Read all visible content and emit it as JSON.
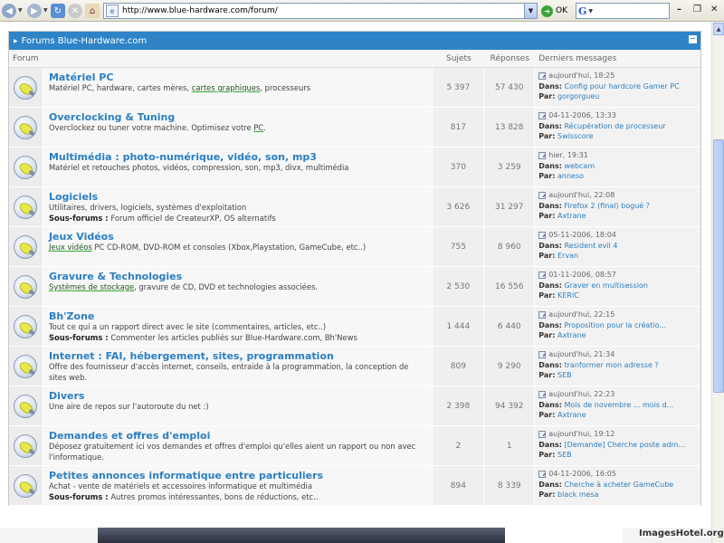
{
  "browser": {
    "url": "http://www.blue-hardware.com/forum/",
    "go_label": "OK"
  },
  "forum": {
    "header_title": "Forums Blue-Hardware.com",
    "columns": {
      "forum": "Forum",
      "topics": "Sujets",
      "posts": "Réponses",
      "last": "Derniers messages"
    },
    "labels": {
      "in": "Dans:",
      "by": "Par:",
      "subforums": "Sous-forums :"
    },
    "rows": [
      {
        "title": "Matériel PC",
        "desc_a": "Matériel PC, hardware, cartes mères, ",
        "desc_link": "cartes graphiques",
        "desc_b": ", processeurs",
        "sub": "",
        "topics": "5 397",
        "posts": "57 430",
        "last_date": "aujourd'hui, 18:25",
        "last_in": "Config pour hardcore Gamer PC",
        "last_by": "gorgorgueu"
      },
      {
        "title": "Overclocking & Tuning",
        "desc_a": "Overclockez ou tuner votre machine. Optimisez votre ",
        "desc_link": "PC",
        "desc_b": ".",
        "sub": "",
        "topics": "817",
        "posts": "13 828",
        "last_date": "04-11-2006, 13:33",
        "last_in": "Récupération de processeur",
        "last_by": "Swisscore"
      },
      {
        "title": "Multimédia : photo-numérique, vidéo, son, mp3",
        "desc_a": "Matériel et retouches photos, vidéos, compression, son, mp3, divx, multimédia",
        "desc_link": "",
        "desc_b": "",
        "sub": "",
        "topics": "370",
        "posts": "3 259",
        "last_date": "hier, 19:31",
        "last_in": "webcam",
        "last_by": "anneso"
      },
      {
        "title": "Logiciels",
        "desc_a": "Utilitaires, drivers, logiciels, systèmes d'exploitation",
        "desc_link": "",
        "desc_b": "",
        "sub": "Forum officiel de CreateurXP, OS alternatifs",
        "topics": "3 626",
        "posts": "31 297",
        "last_date": "aujourd'hui, 22:08",
        "last_in": "Firefox 2 (final) bogué ?",
        "last_by": "Axtrane"
      },
      {
        "title": "Jeux Vidéos",
        "desc_a": "",
        "desc_link": "Jeux vidéos",
        "desc_b": " PC CD-ROM, DVD-ROM et consoles (Xbox,Playstation, GameCube, etc..)",
        "sub": "",
        "topics": "755",
        "posts": "8 960",
        "last_date": "05-11-2006, 18:04",
        "last_in": "Resident evil 4",
        "last_by": "Ervan"
      },
      {
        "title": "Gravure & Technologies",
        "desc_a": "",
        "desc_link": "Systèmes de stockage",
        "desc_b": ", gravure de CD, DVD et technologies associées.",
        "sub": "",
        "topics": "2 530",
        "posts": "16 556",
        "last_date": "01-11-2006, 08:57",
        "last_in": "Graver en multisession",
        "last_by": "KERIC"
      },
      {
        "title": "Bh'Zone",
        "desc_a": "Tout ce qui a un rapport direct avec le site (commentaires, articles, etc..)",
        "desc_link": "",
        "desc_b": "",
        "sub": "Commenter les articles publiés sur Blue-Hardware.com, Bh'News",
        "topics": "1 444",
        "posts": "6 440",
        "last_date": "aujourd'hui, 22:15",
        "last_in": "Proposition pour la créatio...",
        "last_by": "Axtrane"
      },
      {
        "title": "Internet : FAI, hébergement, sites, programmation",
        "desc_a": "Offre des fournisseur d'accès internet, conseils, entraide à la programmation, la conception de sites web.",
        "desc_link": "",
        "desc_b": "",
        "sub": "",
        "topics": "809",
        "posts": "9 290",
        "last_date": "aujourd'hui, 21:34",
        "last_in": "tranformer mon adresse ?",
        "last_by": "SEB"
      },
      {
        "title": "Divers",
        "desc_a": "Une aire de repos sur l'autoroute du net :)",
        "desc_link": "",
        "desc_b": "",
        "sub": "",
        "topics": "2 398",
        "posts": "94 392",
        "last_date": "aujourd'hui, 22:23",
        "last_in": "Mois de novembre ... mois d...",
        "last_by": "Axtrane"
      },
      {
        "title": "Demandes et offres d'emploi",
        "desc_a": "Déposez gratuitement ici vos demandes et offres d'emploi qu'elles aient un rapport ou non avec l'informatique.",
        "desc_link": "",
        "desc_b": "",
        "sub": "",
        "topics": "2",
        "posts": "1",
        "last_date": "aujourd'hui, 19:12",
        "last_in": "[Demande] Cherche poste adm...",
        "last_by": "SEB"
      },
      {
        "title": "Petites annonces informatique entre particuliers",
        "desc_a": "Achat - vente de matériels et accessoires informatique et multimédia",
        "desc_link": "",
        "desc_b": "",
        "sub": "Autres promos intéressantes, bons de réductions, etc..",
        "topics": "894",
        "posts": "8 339",
        "last_date": "04-11-2006, 16:05",
        "last_in": "Cherche à acheter GameCube",
        "last_by": "black mesa"
      }
    ]
  },
  "footer": {
    "watermark": "ImagesHotel.org"
  },
  "colors": {
    "header_blue": "#2e84c6",
    "title_blue": "#2b7fc1",
    "link_green": "#33aa33"
  }
}
